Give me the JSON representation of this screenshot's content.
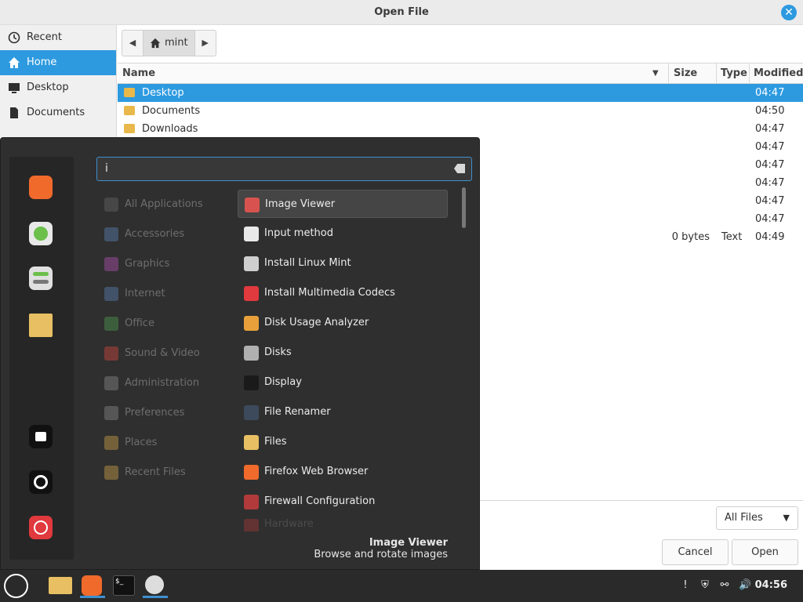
{
  "window": {
    "title": "Open File"
  },
  "places": [
    {
      "label": "Recent",
      "icon": "clock-icon"
    },
    {
      "label": "Home",
      "icon": "home-icon",
      "active": true
    },
    {
      "label": "Desktop",
      "icon": "desktop-icon"
    },
    {
      "label": "Documents",
      "icon": "document-icon"
    }
  ],
  "pathbar": {
    "crumb": "mint"
  },
  "columns": {
    "name": "Name",
    "size": "Size",
    "type": "Type",
    "modified": "Modified"
  },
  "files": [
    {
      "name": "Desktop",
      "size": "",
      "type": "",
      "modified": "04:47",
      "selected": true
    },
    {
      "name": "Documents",
      "size": "",
      "type": "",
      "modified": "04:50"
    },
    {
      "name": "Downloads",
      "size": "",
      "type": "",
      "modified": "04:47"
    },
    {
      "name": "",
      "size": "",
      "type": "",
      "modified": "04:47"
    },
    {
      "name": "",
      "size": "",
      "type": "",
      "modified": "04:47"
    },
    {
      "name": "",
      "size": "",
      "type": "",
      "modified": "04:47"
    },
    {
      "name": "",
      "size": "",
      "type": "",
      "modified": "04:47"
    },
    {
      "name": "",
      "size": "",
      "type": "",
      "modified": "04:47"
    },
    {
      "name": "",
      "size": "0 bytes",
      "type": "Text",
      "modified": "04:49"
    }
  ],
  "filter": {
    "selected": "All Files"
  },
  "buttons": {
    "cancel": "Cancel",
    "open": "Open"
  },
  "menu": {
    "search_value": "i",
    "categories": [
      "All Applications",
      "Accessories",
      "Graphics",
      "Internet",
      "Office",
      "Sound & Video",
      "Administration",
      "Preferences",
      "Places",
      "Recent Files"
    ],
    "apps": [
      {
        "label": "Image Viewer",
        "color": "#d8534f",
        "selected": true
      },
      {
        "label": "Input method",
        "color": "#e8e8e8"
      },
      {
        "label": "Install Linux Mint",
        "color": "#cfcfcf"
      },
      {
        "label": "Install Multimedia Codecs",
        "color": "#e0393e"
      },
      {
        "label": "Disk Usage Analyzer",
        "color": "#e8a13a"
      },
      {
        "label": "Disks",
        "color": "#b0b0b0"
      },
      {
        "label": "Display",
        "color": "#1a1a1a"
      },
      {
        "label": "File Renamer",
        "color": "#3d4a5c"
      },
      {
        "label": "Files",
        "color": "#e8c063"
      },
      {
        "label": "Firefox Web Browser",
        "color": "#f06a2c"
      },
      {
        "label": "Firewall Configuration",
        "color": "#b23a3a"
      },
      {
        "label": "Hardware",
        "color": "#b23a3a",
        "faded": true
      }
    ],
    "description": {
      "name": "Image Viewer",
      "text": "Browse and rotate images"
    }
  },
  "taskbar": {
    "time": "04:56"
  }
}
